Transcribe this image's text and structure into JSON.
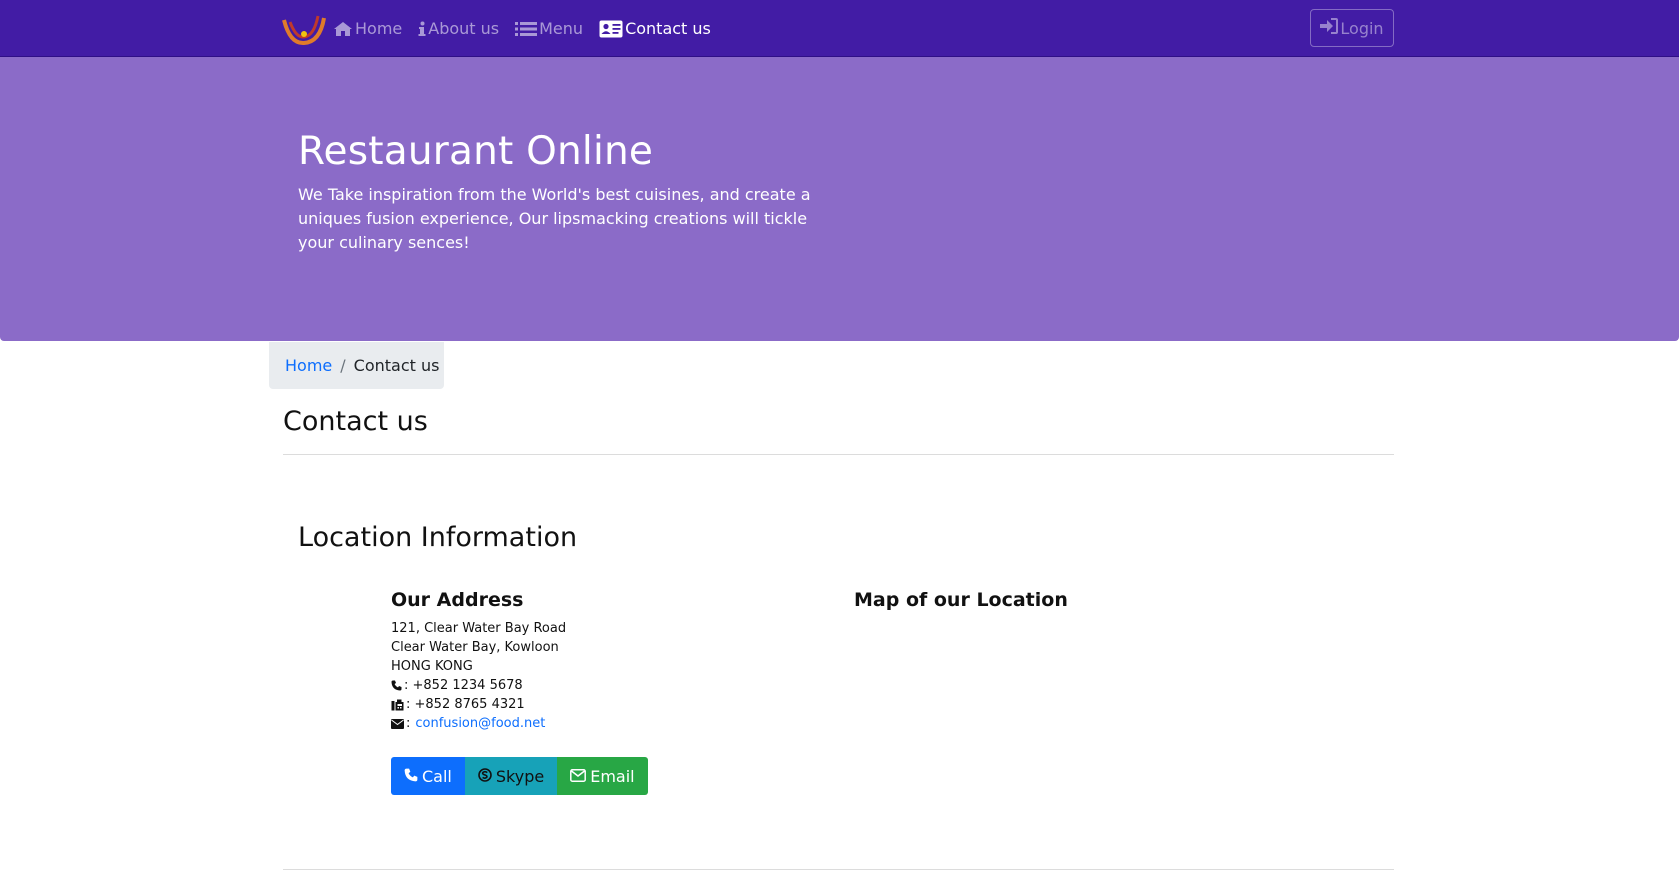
{
  "navbar": {
    "items": [
      {
        "label": "Home",
        "icon": "home-icon"
      },
      {
        "label": "About us",
        "icon": "info-icon"
      },
      {
        "label": "Menu",
        "icon": "list-icon"
      },
      {
        "label": "Contact us",
        "icon": "address-card-icon",
        "active": true
      }
    ],
    "login_label": "Login",
    "background": "#421ca5"
  },
  "jumbotron": {
    "title": "Restaurant Online",
    "text": "We Take inspiration from the World's best cuisines, and create a uniques fusion experience, Our lipsmacking creations will tickle your culinary sences!",
    "background": "#8b6bc8"
  },
  "breadcrumb": {
    "home": "Home",
    "separator": "/",
    "current": "Contact us"
  },
  "page_title": "Contact us",
  "location": {
    "title": "Location Information",
    "address_title": "Our Address",
    "address_lines": [
      "121, Clear Water Bay Road",
      "Clear Water Bay, Kowloon",
      "HONG KONG"
    ],
    "phone": ": +852 1234 5678",
    "fax": ": +852 8765 4321",
    "email_prefix": ":",
    "email": "confusion@food.net",
    "map_title": "Map of our Location"
  },
  "buttons": {
    "call": "Call",
    "skype": "Skype",
    "email": "Email"
  }
}
